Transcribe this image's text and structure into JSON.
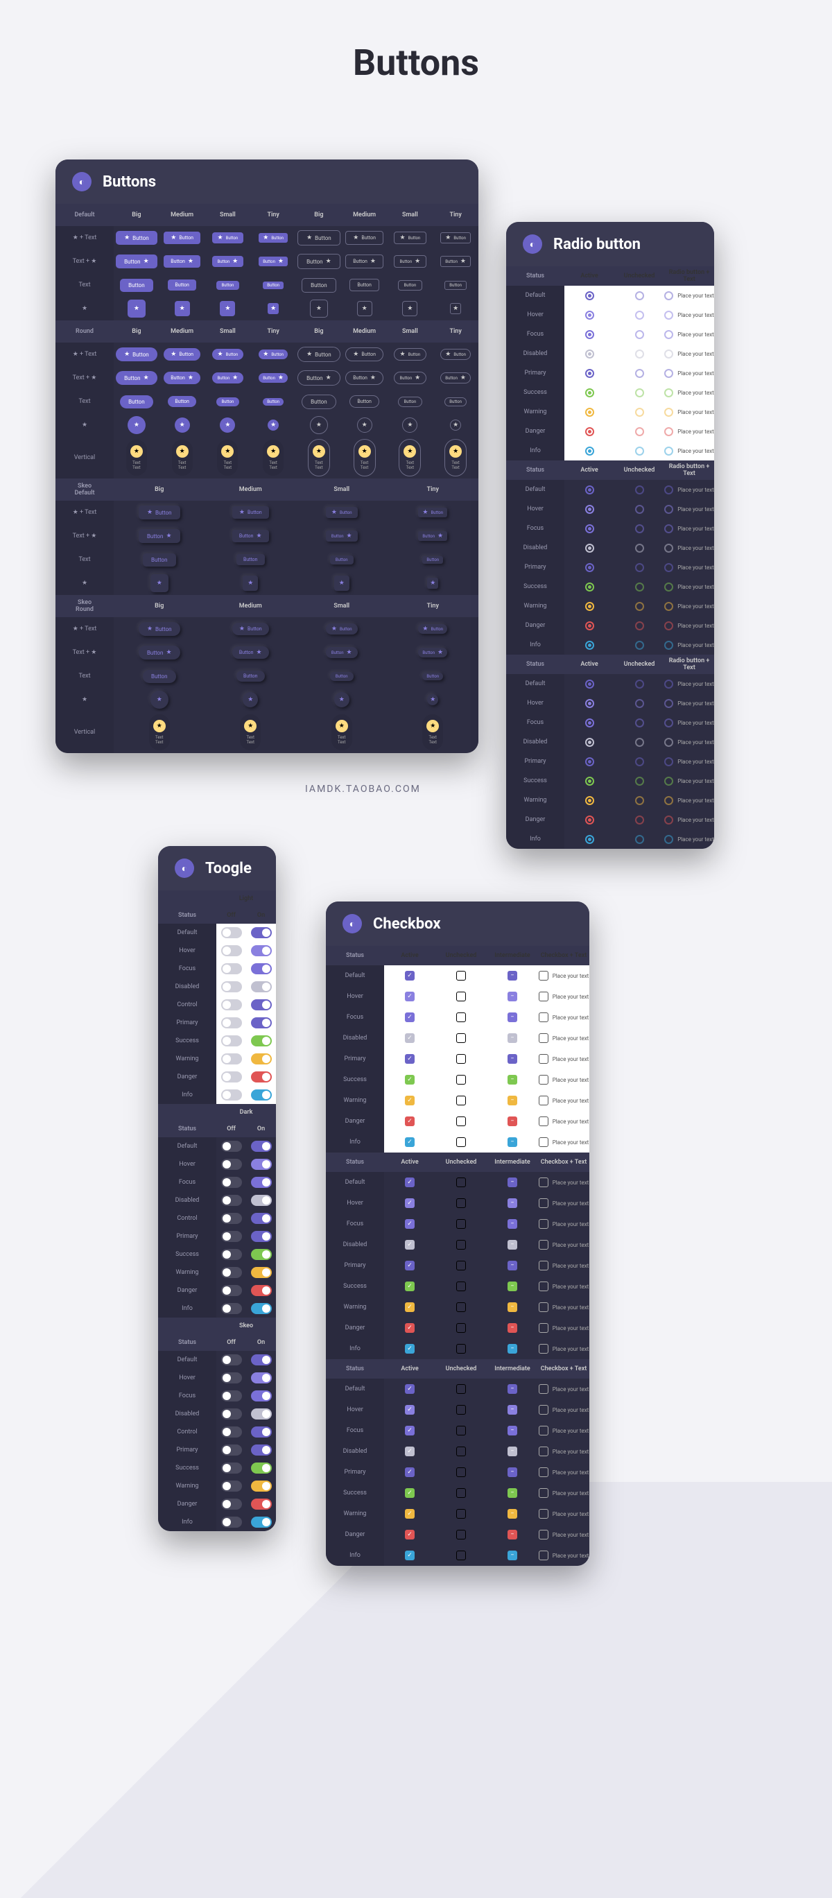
{
  "page": {
    "title": "Buttons"
  },
  "panels": {
    "buttons": {
      "title": "Buttons",
      "rowLabels": [
        "Default",
        "★ + Text",
        "Text + ★",
        "Text",
        "★",
        "Round",
        "★ + Text",
        "Text + ★",
        "Text",
        "★",
        "Vertical",
        "Skeo Default",
        "★ + Text",
        "Text + ★",
        "Text",
        "★",
        "Skeo Round",
        "★ + Text",
        "Text + ★",
        "Text",
        "★",
        "Vertical"
      ],
      "sizes": [
        "Big",
        "Medium",
        "Small",
        "Tiny"
      ],
      "btnLabel": "Button",
      "vertLabel": "Text\nText"
    },
    "radio": {
      "title": "Radio button",
      "cols": [
        "Active",
        "Unchecked",
        "Radio button + Text"
      ],
      "statusLabel": "Status",
      "placeholder": "Place your text"
    },
    "toggle": {
      "title": "Toogle",
      "themes": [
        "Light",
        "Dark",
        "Skeo"
      ],
      "cols": [
        "Off",
        "On"
      ],
      "statusLabel": "Status"
    },
    "checkbox": {
      "title": "Checkbox",
      "cols": [
        "Active",
        "Unchecked",
        "Intermediate",
        "Checkbox + Text"
      ],
      "statusLabel": "Status",
      "placeholder": "Place your text"
    }
  },
  "states": [
    "Default",
    "Hover",
    "Focus",
    "Disabled",
    "Control",
    "Primary",
    "Success",
    "Warning",
    "Danger",
    "Info"
  ],
  "statesShort": [
    "Default",
    "Hover",
    "Focus",
    "Disabled",
    "Primary",
    "Success",
    "Warning",
    "Danger",
    "Info"
  ],
  "watermark": "IAMDK.TAOBAO.COM"
}
